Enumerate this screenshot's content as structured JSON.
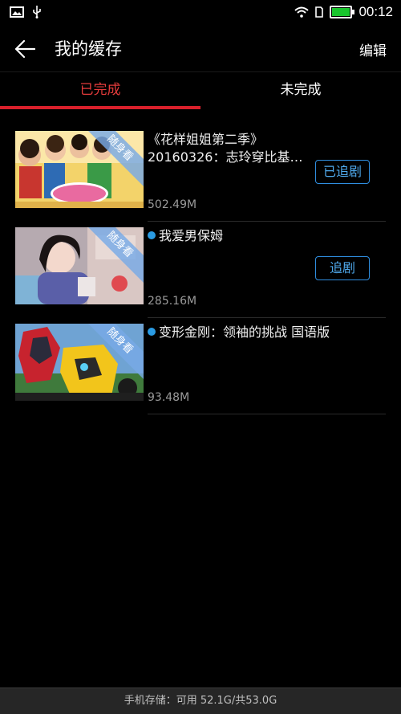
{
  "status_bar": {
    "time": "00:12"
  },
  "header": {
    "title": "我的缓存",
    "edit_label": "编辑"
  },
  "tabs": [
    {
      "label": "已完成"
    },
    {
      "label": "未完成"
    }
  ],
  "ribbon_label": "随身看",
  "items": [
    {
      "title_line1": "《花样姐姐第二季》",
      "title_line2": "20160326：志玲穿比基…",
      "size": "502.49M",
      "follow_label": "已追剧",
      "new_dot": false
    },
    {
      "title_line1": "我爱男保姆",
      "title_line2": "",
      "size": "285.16M",
      "follow_label": "追剧",
      "new_dot": true
    },
    {
      "title_line1": "变形金刚：领袖的挑战 国语版",
      "title_line2": "",
      "size": "93.48M",
      "follow_label": "",
      "new_dot": true
    }
  ],
  "footer": {
    "storage_text": "手机存储：可用  52.1G/共53.0G"
  },
  "colors": {
    "accent_red": "#d9202b",
    "accent_blue": "#2f8ee0",
    "background": "#000000"
  }
}
